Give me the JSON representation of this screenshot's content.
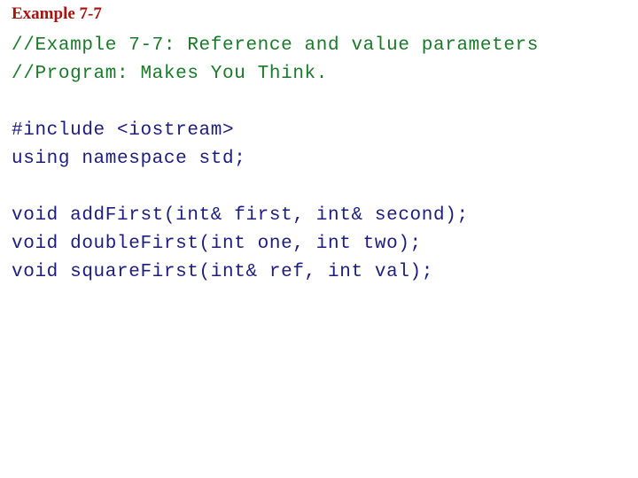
{
  "slide": {
    "title": "Example 7-7",
    "title_color": "#aa1111",
    "background_color": "#ffffff",
    "comment_color": "#1a7a2a",
    "code_color": "#1d1d80",
    "lines": [
      {
        "text": "//Example 7-7: Reference and value parameters",
        "kind": "comment"
      },
      {
        "text": "//Program: Makes You Think.",
        "kind": "comment"
      },
      {
        "text": "",
        "kind": "blank"
      },
      {
        "text": "#include <iostream>",
        "kind": "code"
      },
      {
        "text": "using namespace std;",
        "kind": "code"
      },
      {
        "text": "",
        "kind": "blank"
      },
      {
        "text": "void addFirst(int& first, int& second);",
        "kind": "code"
      },
      {
        "text": "void doubleFirst(int one, int two);",
        "kind": "code"
      },
      {
        "text": "void squareFirst(int& ref, int val);",
        "kind": "code"
      }
    ]
  }
}
